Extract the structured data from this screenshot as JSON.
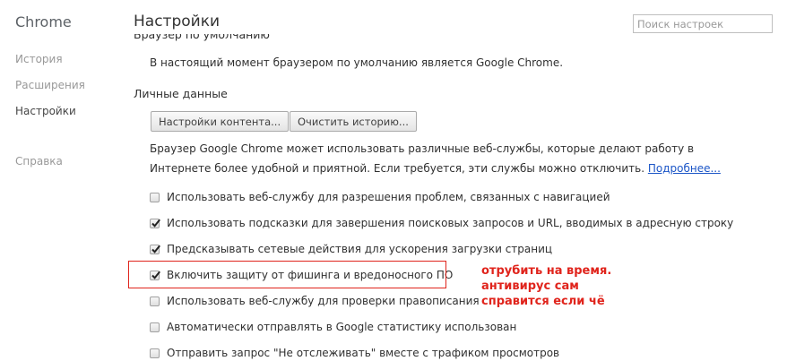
{
  "sidebar": {
    "brand": "Chrome",
    "items": [
      {
        "label": "История"
      },
      {
        "label": "Расширения"
      },
      {
        "label": "Настройки",
        "active": true
      },
      {
        "label": "Справка"
      }
    ]
  },
  "header": {
    "title": "Настройки",
    "search_placeholder": "Поиск настроек"
  },
  "default_browser": {
    "heading_cut": "Браузер по умолчанию",
    "status": "В настоящий момент браузером по умолчанию является Google Chrome."
  },
  "privacy": {
    "title": "Личные данные",
    "content_settings_label": "Настройки контента...",
    "clear_history_label": "Очистить историю...",
    "desc_line1": "Браузер Google Chrome может использовать различные веб-службы, которые делают работу в",
    "desc_line2": "Интернете более удобной и приятной. Если требуется, эти службы можно отключить. ",
    "more_link": "Подробнее...",
    "options": [
      {
        "label": "Использовать веб-службу для разрешения проблем, связанных с навигацией",
        "checked": false
      },
      {
        "label": "Использовать подсказки для завершения поисковых запросов и URL, вводимых в адресную строку",
        "checked": true
      },
      {
        "label": "Предсказывать сетевые действия для ускорения загрузки страниц",
        "checked": true
      },
      {
        "label": "Включить защиту от фишинга и вредоносного ПО",
        "checked": true
      },
      {
        "label": "Использовать веб-службу для проверки правописания",
        "checked": false
      },
      {
        "label": "Автоматически отправлять в Google статистику использован",
        "checked": false
      },
      {
        "label": "Отправить запрос \"Не отслеживать\" вместе с трафиком просмотров",
        "checked": false
      }
    ]
  },
  "annotation": {
    "color": "#e0241c",
    "lines": [
      "отрубить на время.",
      "антивирус сам",
      "справится если чё"
    ]
  }
}
